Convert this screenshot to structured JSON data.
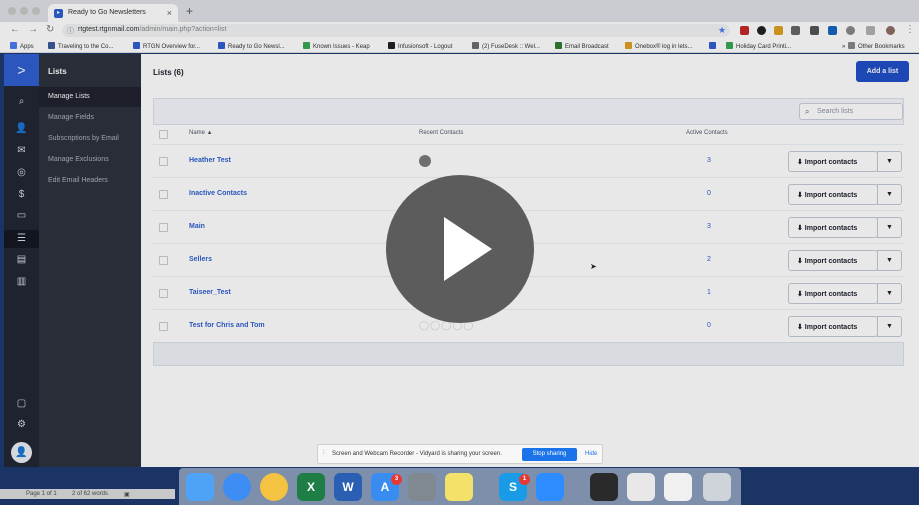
{
  "browser": {
    "tab_title": "Ready to Go Newsletters",
    "tab_close": "×",
    "new_tab": "+",
    "url_host": "rtgtest.rtgnmail.com",
    "url_path": "/admin/main.php?action=list",
    "bookmarks": [
      {
        "label": "Apps",
        "color": "#4a7cf0"
      },
      {
        "label": "Traveling to the Co...",
        "color": "#3b5998"
      },
      {
        "label": "RTGN Overview for...",
        "color": "#2f5fd0"
      },
      {
        "label": "Ready to Go Newsl...",
        "color": "#2f5fd0"
      },
      {
        "label": "Known Issues - Keap",
        "color": "#3aa655"
      },
      {
        "label": "Infusionsoft - Logout",
        "color": "#222222"
      },
      {
        "label": "(2) FuseDesk :: Wel...",
        "color": "#6d6d6d"
      },
      {
        "label": "Email Broadcast",
        "color": "#2e7d32"
      },
      {
        "label": "Onebox® log in lets...",
        "color": "#e0a020"
      },
      {
        "label": "",
        "color": "#2f5fd0"
      },
      {
        "label": "Holiday Card Printi...",
        "color": "#3aa655"
      },
      {
        "label": "»",
        "color": "transparent"
      },
      {
        "label": "Other Bookmarks",
        "color": "#888888"
      }
    ]
  },
  "app": {
    "brand_icon": ">",
    "nav_icons": [
      {
        "name": "search-icon",
        "glyph": "⌕"
      },
      {
        "name": "contacts-icon",
        "glyph": "👤"
      },
      {
        "name": "email-icon",
        "glyph": "✉"
      },
      {
        "name": "automation-icon",
        "glyph": "◎"
      },
      {
        "name": "deals-icon",
        "glyph": "$"
      },
      {
        "name": "conversations-icon",
        "glyph": "▭"
      },
      {
        "name": "lists-icon",
        "glyph": "☰"
      },
      {
        "name": "site-icon",
        "glyph": "▤"
      },
      {
        "name": "reports-icon",
        "glyph": "▥"
      }
    ],
    "bottom_icons": [
      {
        "name": "pages-icon",
        "glyph": "▢"
      },
      {
        "name": "settings-icon",
        "glyph": "⚙"
      }
    ],
    "avatar": "👤",
    "sidebar": {
      "title": "Lists",
      "items": [
        {
          "label": "Manage Lists"
        },
        {
          "label": "Manage Fields"
        },
        {
          "label": "Subscriptions by Email"
        },
        {
          "label": "Manage Exclusions"
        },
        {
          "label": "Edit Email Headers"
        }
      ]
    }
  },
  "main": {
    "page_title": "Lists (6)",
    "add_button": "Add a list",
    "search_placeholder": "Search lists",
    "columns": {
      "name": "Name ▲",
      "recent": "Recent Contacts",
      "active": "Active Contacts"
    },
    "rows": [
      {
        "name": "Heather Test",
        "active": "3",
        "avatar_type": "photo"
      },
      {
        "name": "Inactive Contacts",
        "active": "0",
        "avatar_type": "none"
      },
      {
        "name": "Main",
        "active": "3",
        "avatar_type": "none"
      },
      {
        "name": "Sellers",
        "active": "2",
        "avatar_type": "none"
      },
      {
        "name": "Taiseer_Test",
        "active": "1",
        "avatar_type": "none"
      },
      {
        "name": "Test for Chris and Tom",
        "active": "0",
        "avatar_type": "blank"
      }
    ],
    "import_label": "⬇ Import contacts",
    "dropdown_glyph": "▼",
    "blank_avatars": "◯◯◯◯◯"
  },
  "overlay": {
    "share_message": "Screen and Webcam Recorder - Vidyard is sharing your screen.",
    "stop_sharing": "Stop sharing",
    "hide": "Hide"
  },
  "word_status": {
    "page": "Page 1 of 1",
    "words": "2 of 62 words"
  },
  "dock": {
    "badges": {
      "appstore": "3",
      "skype": "1"
    }
  }
}
